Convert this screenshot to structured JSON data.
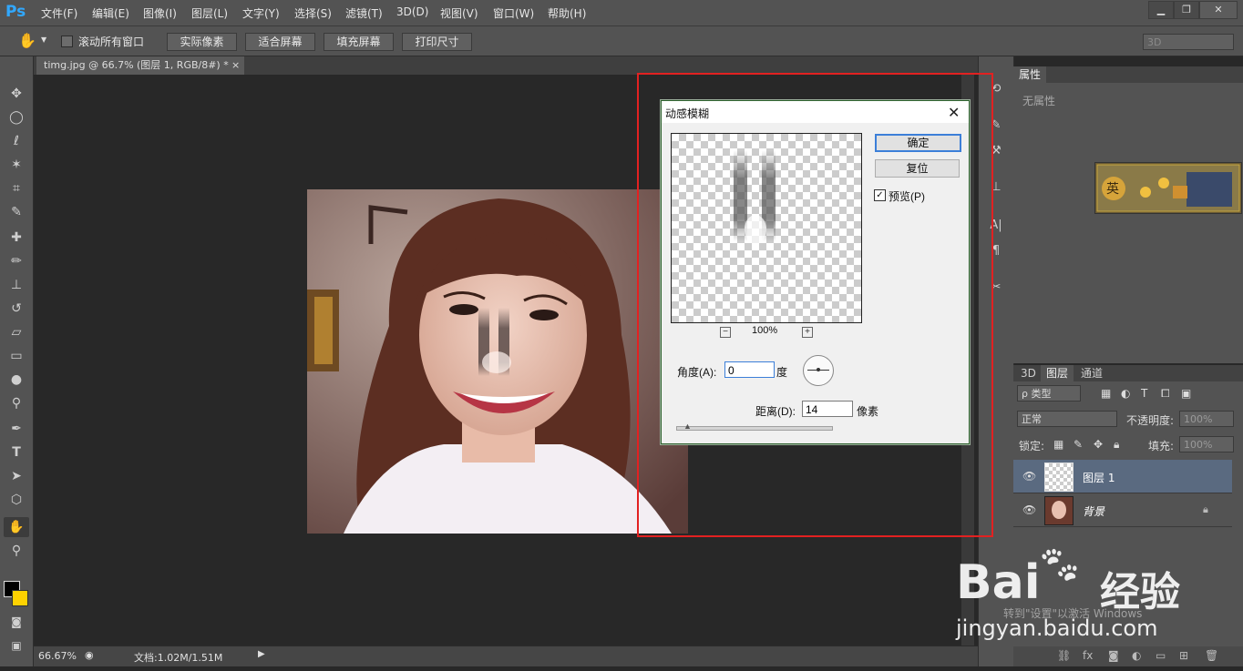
{
  "app": {
    "logo": "Ps"
  },
  "menu": [
    "文件(F)",
    "编辑(E)",
    "图像(I)",
    "图层(L)",
    "文字(Y)",
    "选择(S)",
    "滤镜(T)",
    "3D(D)",
    "视图(V)",
    "窗口(W)",
    "帮助(H)"
  ],
  "options": {
    "scroll_all_label": "滚动所有窗口",
    "btn_actual": "实际像素",
    "btn_fit": "适合屏幕",
    "btn_fill": "填充屏幕",
    "btn_print": "打印尺寸",
    "workspace": "3D"
  },
  "document": {
    "tab_title": "timg.jpg @ 66.7% (图层 1, RGB/8#) *",
    "tab_close": "×"
  },
  "status": {
    "zoom": "66.67%",
    "doc": "文档:1.02M/1.51M"
  },
  "properties": {
    "tab": "属性",
    "empty": "无属性"
  },
  "layers_panel": {
    "tabs": [
      "3D",
      "图层",
      "通道"
    ],
    "filter_kind": "ρ 类型",
    "blend_mode": "正常",
    "opacity_label": "不透明度:",
    "opacity_value": "100%",
    "lock_label": "锁定:",
    "fill_label": "填充:",
    "fill_value": "100%",
    "layers": [
      {
        "name": "图层 1",
        "selected": true
      },
      {
        "name": "背景",
        "locked": true
      }
    ]
  },
  "dialog": {
    "title": "动感模糊",
    "ok": "确定",
    "reset": "复位",
    "preview_label": "预览(P)",
    "preview_checked": true,
    "zoom": "100%",
    "zoom_minus": "−",
    "zoom_plus": "+",
    "angle_label": "角度(A):",
    "angle_value": "0",
    "angle_unit": "度",
    "distance_label": "距离(D):",
    "distance_value": "14",
    "distance_unit": "像素"
  },
  "watermark": {
    "brand": "Bai",
    "brand_suffix": "经验",
    "url": "jingyan.baidu.com",
    "activation": "转到\"设置\"以激活 Windows"
  },
  "colors": {
    "ps_blue": "#31a8ff",
    "highlight_red": "#e22121",
    "default_button_border": "#3c7fd8"
  }
}
